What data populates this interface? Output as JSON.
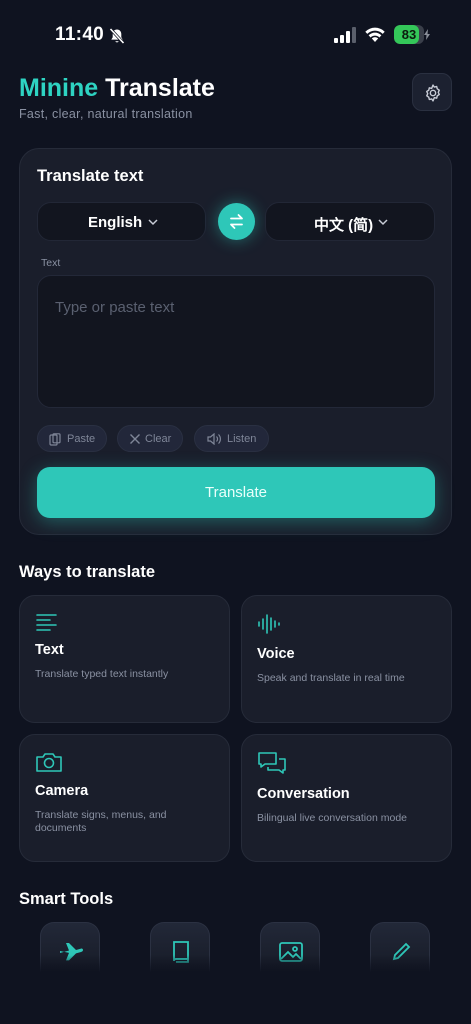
{
  "status": {
    "time": "11:40",
    "battery": "83",
    "battery_level": 0.83
  },
  "header": {
    "brand": "Minine",
    "title_rest": "Translate",
    "subtitle": "Fast, clear, natural translation"
  },
  "translate_card": {
    "title": "Translate text",
    "source_lang": "English",
    "target_lang": "中文 (简)",
    "field_label": "Text",
    "placeholder": "Type or paste text",
    "chips": {
      "paste": "Paste",
      "clear": "Clear",
      "listen": "Listen"
    },
    "translate_button": "Translate"
  },
  "ways": {
    "title": "Ways to translate",
    "items": [
      {
        "icon": "text-lines-icon",
        "title": "Text",
        "desc": "Translate typed text instantly"
      },
      {
        "icon": "waveform-icon",
        "title": "Voice",
        "desc": "Speak and translate in real time"
      },
      {
        "icon": "camera-icon",
        "title": "Camera",
        "desc": "Translate signs, menus, and documents"
      },
      {
        "icon": "chat-bubbles-icon",
        "title": "Conversation",
        "desc": "Bilingual live conversation mode"
      }
    ]
  },
  "smart_tools": {
    "title": "Smart Tools",
    "items": [
      "airplane-icon",
      "book-icon",
      "image-icon",
      "pen-icon"
    ]
  },
  "colors": {
    "accent": "#2ed3c2",
    "background": "#0f1320",
    "card": "#1a1e2b"
  }
}
